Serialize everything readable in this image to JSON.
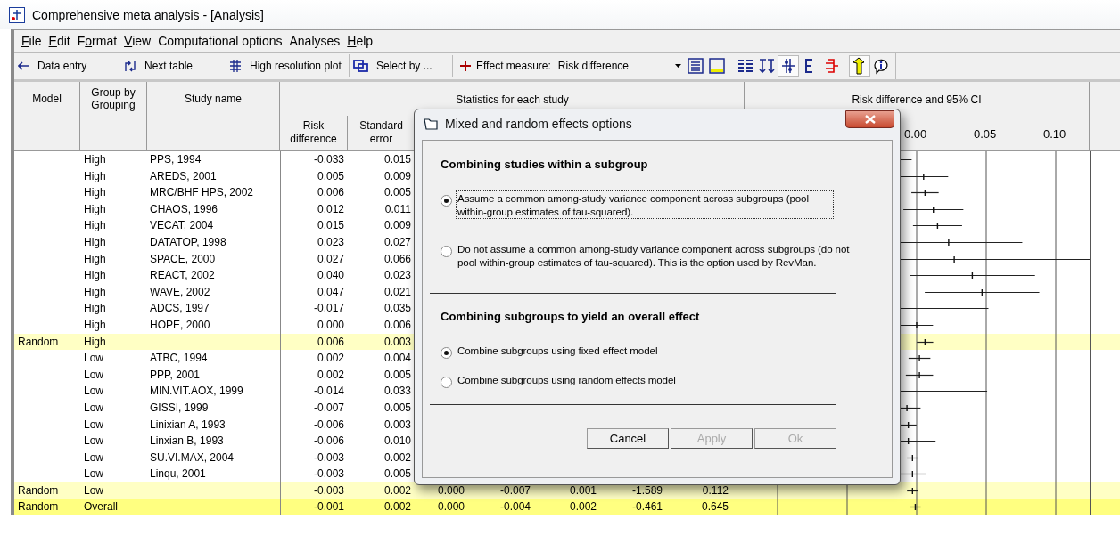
{
  "window": {
    "title": "Comprehensive meta analysis - [Analysis]"
  },
  "menu": [
    {
      "access_key": "F",
      "rest": "ile"
    },
    {
      "access_key": "E",
      "rest": "dit"
    },
    {
      "prefix": "F",
      "access_key": "o",
      "rest": "rmat"
    },
    {
      "access_key": "V",
      "rest": "iew"
    },
    {
      "rest": "Computational options"
    },
    {
      "rest": "Analyses"
    },
    {
      "access_key": "H",
      "rest": "elp"
    }
  ],
  "toolbar": [
    {
      "label": "Data entry"
    },
    {
      "label": "Next table"
    },
    {
      "label": "High resolution plot"
    },
    {
      "label": "Select by ..."
    }
  ],
  "effect_measure": {
    "label": "Effect measure:",
    "value": "Risk difference"
  },
  "icon_buttons": [
    {
      "pressed": false
    },
    {
      "pressed": false
    },
    {
      "pressed": false
    },
    {
      "pressed": false
    },
    {
      "pressed": true
    },
    {
      "pressed": false
    },
    {
      "pressed": false
    },
    {
      "pressed": true
    },
    {
      "pressed": false
    }
  ],
  "table": {
    "columns": {
      "model": "Model",
      "group": "Group by\nGrouping",
      "study": "Study name",
      "statistics": "Statistics for each study",
      "risk_difference": "Risk difference",
      "standard_error": "Standard error",
      "plot": "Risk difference and 95% CI"
    },
    "plot_ticks": [
      "0.00",
      "0.05",
      "0.10"
    ],
    "rows": [
      {
        "kind": "study",
        "group": "High",
        "study": "PPS, 1994",
        "risk_difference": "-0.033",
        "standard_error": "0.015"
      },
      {
        "kind": "study",
        "group": "High",
        "study": "AREDS, 2001",
        "risk_difference": "0.005",
        "standard_error": "0.009"
      },
      {
        "kind": "study",
        "group": "High",
        "study": "MRC/BHF HPS, 2002",
        "risk_difference": "0.006",
        "standard_error": "0.005"
      },
      {
        "kind": "study",
        "group": "High",
        "study": "CHAOS, 1996",
        "risk_difference": "0.012",
        "standard_error": "0.011"
      },
      {
        "kind": "study",
        "group": "High",
        "study": "VECAT, 2004",
        "risk_difference": "0.015",
        "standard_error": "0.009"
      },
      {
        "kind": "study",
        "group": "High",
        "study": "DATATOP, 1998",
        "risk_difference": "0.023",
        "standard_error": "0.027"
      },
      {
        "kind": "study",
        "group": "High",
        "study": "SPACE, 2000",
        "risk_difference": "0.027",
        "standard_error": "0.066"
      },
      {
        "kind": "study",
        "group": "High",
        "study": "REACT, 2002",
        "risk_difference": "0.040",
        "standard_error": "0.023"
      },
      {
        "kind": "study",
        "group": "High",
        "study": "WAVE, 2002",
        "risk_difference": "0.047",
        "standard_error": "0.021"
      },
      {
        "kind": "study",
        "group": "High",
        "study": "ADCS, 1997",
        "risk_difference": "-0.017",
        "standard_error": "0.035"
      },
      {
        "kind": "study",
        "group": "High",
        "study": "HOPE, 2000",
        "risk_difference": "0.000",
        "standard_error": "0.006"
      },
      {
        "kind": "subgroup",
        "model": "Random",
        "group": "High",
        "risk_difference": "0.006",
        "standard_error": "0.003"
      },
      {
        "kind": "study",
        "group": "Low",
        "study": "ATBC, 1994",
        "risk_difference": "0.002",
        "standard_error": "0.004"
      },
      {
        "kind": "study",
        "group": "Low",
        "study": "PPP, 2001",
        "risk_difference": "0.002",
        "standard_error": "0.005"
      },
      {
        "kind": "study",
        "group": "Low",
        "study": "MIN.VIT.AOX, 1999",
        "risk_difference": "-0.014",
        "standard_error": "0.033"
      },
      {
        "kind": "study",
        "group": "Low",
        "study": "GISSI, 1999",
        "risk_difference": "-0.007",
        "standard_error": "0.005"
      },
      {
        "kind": "study",
        "group": "Low",
        "study": "Linixian A, 1993",
        "risk_difference": "-0.006",
        "standard_error": "0.003"
      },
      {
        "kind": "study",
        "group": "Low",
        "study": "Linxian B, 1993",
        "risk_difference": "-0.006",
        "standard_error": "0.010"
      },
      {
        "kind": "study",
        "group": "Low",
        "study": "SU.VI.MAX, 2004",
        "risk_difference": "-0.003",
        "standard_error": "0.002"
      },
      {
        "kind": "study",
        "group": "Low",
        "study": "Linqu, 2001",
        "risk_difference": "-0.003",
        "standard_error": "0.005"
      },
      {
        "kind": "subgroup",
        "model": "Random",
        "group": "Low",
        "risk_difference": "-0.003",
        "standard_error": "0.002",
        "columns_6_to_10": [
          "0.000",
          "-0.007",
          "0.001",
          "-1.589",
          "0.112"
        ]
      },
      {
        "kind": "overall",
        "model": "Random",
        "group": "Overall",
        "risk_difference": "-0.001",
        "standard_error": "0.002",
        "columns_6_to_10": [
          "0.000",
          "-0.004",
          "0.002",
          "-0.461",
          "0.645"
        ]
      }
    ]
  },
  "dialog": {
    "title": "Mixed and random effects options",
    "sections": [
      {
        "heading": "Combining studies within a subgroup",
        "options": [
          {
            "label": "Assume a common among-study variance component across subgroups (pool within-group estimates of tau-squared).",
            "selected": true,
            "focused": true
          },
          {
            "label": "Do not assume a common among-study variance component across subgroups (do not pool within-group estimates of tau-squared). This is the option used by RevMan.",
            "selected": false,
            "focused": false
          }
        ]
      },
      {
        "heading": "Combining subgroups to yield an overall effect",
        "options": [
          {
            "label": "Combine subgroups using fixed effect model",
            "selected": true,
            "focused": false
          },
          {
            "label": "Combine subgroups using random effects model",
            "selected": false,
            "focused": false
          }
        ]
      }
    ],
    "buttons": [
      {
        "label": "Cancel",
        "disabled": false
      },
      {
        "label": "Apply",
        "disabled": true
      },
      {
        "label": "Ok",
        "disabled": true
      }
    ]
  }
}
